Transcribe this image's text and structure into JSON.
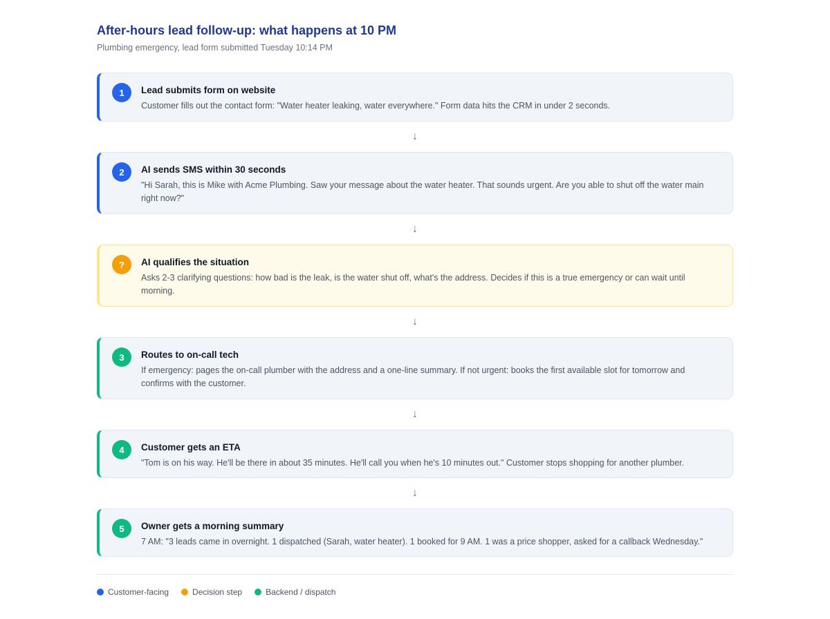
{
  "title": "After-hours lead follow-up: what happens at 10 PM",
  "subtitle": "Plumbing emergency, lead form submitted Tuesday 10:14 PM",
  "arrow_glyph": "↓",
  "colors": {
    "customer_facing": "#2563eb",
    "decision": "#f59e0b",
    "backend": "#10b981"
  },
  "steps": [
    {
      "badge": "1",
      "kind": "customer",
      "title": "Lead submits form on website",
      "desc": "Customer fills out the contact form: \"Water heater leaking, water everywhere.\" Form data hits the CRM in under 2 seconds."
    },
    {
      "badge": "2",
      "kind": "customer",
      "title": "AI sends SMS within 30 seconds",
      "desc": "\"Hi Sarah, this is Mike with Acme Plumbing. Saw your message about the water heater. That sounds urgent. Are you able to shut off the water main right now?\""
    },
    {
      "badge": "?",
      "kind": "decision",
      "title": "AI qualifies the situation",
      "desc": "Asks 2-3 clarifying questions: how bad is the leak, is the water shut off, what's the address. Decides if this is a true emergency or can wait until morning."
    },
    {
      "badge": "3",
      "kind": "backend",
      "title": "Routes to on-call tech",
      "desc": "If emergency: pages the on-call plumber with the address and a one-line summary. If not urgent: books the first available slot for tomorrow and confirms with the customer."
    },
    {
      "badge": "4",
      "kind": "backend",
      "title": "Customer gets an ETA",
      "desc": "\"Tom is on his way. He'll be there in about 35 minutes. He'll call you when he's 10 minutes out.\" Customer stops shopping for another plumber."
    },
    {
      "badge": "5",
      "kind": "backend",
      "title": "Owner gets a morning summary",
      "desc": "7 AM: \"3 leads came in overnight. 1 dispatched (Sarah, water heater). 1 booked for 9 AM. 1 was a price shopper, asked for a callback Wednesday.\""
    }
  ],
  "legend": [
    {
      "label": "Customer-facing",
      "color": "#2563eb"
    },
    {
      "label": "Decision step",
      "color": "#f59e0b"
    },
    {
      "label": "Backend / dispatch",
      "color": "#10b981"
    }
  ]
}
